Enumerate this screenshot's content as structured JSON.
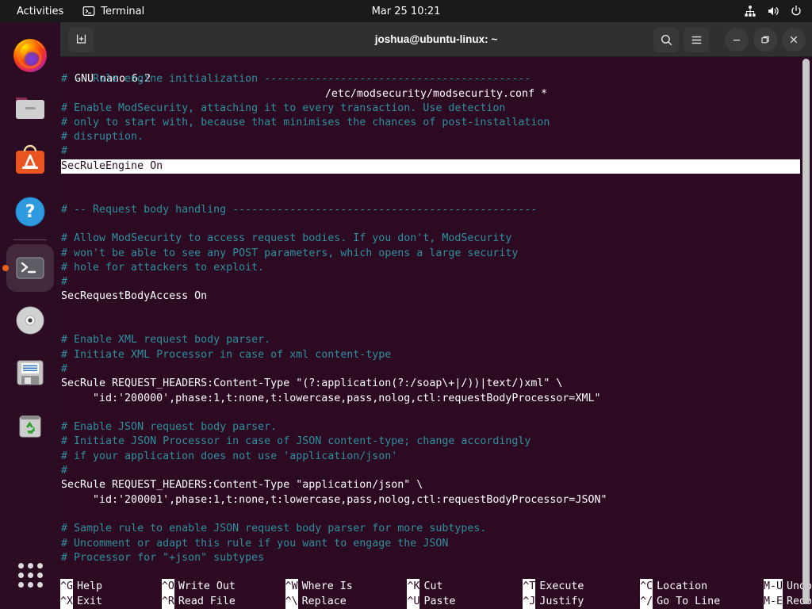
{
  "topbar": {
    "activities_label": "Activities",
    "app_label": "Terminal",
    "clock": "Mar 25  10:21",
    "icons": [
      "network-icon",
      "volume-icon",
      "power-icon"
    ]
  },
  "dock": {
    "items": [
      {
        "name": "firefox",
        "label": "Firefox"
      },
      {
        "name": "files",
        "label": "Files"
      },
      {
        "name": "ubuntu-software",
        "label": "Ubuntu Software"
      },
      {
        "name": "help",
        "label": "Help"
      },
      {
        "name": "terminal",
        "label": "Terminal",
        "running": true
      },
      {
        "name": "cd-drive",
        "label": "CD Drive"
      },
      {
        "name": "disk-image",
        "label": "Disk"
      },
      {
        "name": "trash",
        "label": "Trash"
      }
    ],
    "show_apps_label": "Show Applications"
  },
  "window": {
    "title": "joshua@ubuntu-linux: ~",
    "new_tab_label": "+",
    "search_label": "search-icon",
    "menu_label": "hamburger-icon",
    "minimize_label": "–",
    "maximize_label": "❐",
    "close_label": "×"
  },
  "nano": {
    "app_title": "GNU nano 6.2",
    "file_title": "/etc/modsecurity/modsecurity.conf *",
    "lines": [
      {
        "text": "# -- Rule engine initialization ------------------------------------------",
        "style": "comment"
      },
      {
        "text": "",
        "style": "plain"
      },
      {
        "text": "# Enable ModSecurity, attaching it to every transaction. Use detection",
        "style": "comment"
      },
      {
        "text": "# only to start with, because that minimises the chances of post-installation",
        "style": "comment"
      },
      {
        "text": "# disruption.",
        "style": "comment"
      },
      {
        "text": "#",
        "style": "comment"
      },
      {
        "text": "SecRuleEngine On",
        "style": "highlight"
      },
      {
        "text": "",
        "style": "plain"
      },
      {
        "text": "",
        "style": "plain"
      },
      {
        "text": "# -- Request body handling ------------------------------------------------",
        "style": "comment"
      },
      {
        "text": "",
        "style": "plain"
      },
      {
        "text": "# Allow ModSecurity to access request bodies. If you don't, ModSecurity",
        "style": "comment"
      },
      {
        "text": "# won't be able to see any POST parameters, which opens a large security",
        "style": "comment"
      },
      {
        "text": "# hole for attackers to exploit.",
        "style": "comment"
      },
      {
        "text": "#",
        "style": "comment"
      },
      {
        "text": "SecRequestBodyAccess On",
        "style": "plain"
      },
      {
        "text": "",
        "style": "plain"
      },
      {
        "text": "",
        "style": "plain"
      },
      {
        "text": "# Enable XML request body parser.",
        "style": "comment"
      },
      {
        "text": "# Initiate XML Processor in case of xml content-type",
        "style": "comment"
      },
      {
        "text": "#",
        "style": "comment"
      },
      {
        "text": "SecRule REQUEST_HEADERS:Content-Type \"(?:application(?:/soap\\+|/))|text/)xml\" \\",
        "style": "plain"
      },
      {
        "text": "     \"id:'200000',phase:1,t:none,t:lowercase,pass,nolog,ctl:requestBodyProcessor=XML\"",
        "style": "plain"
      },
      {
        "text": "",
        "style": "plain"
      },
      {
        "text": "# Enable JSON request body parser.",
        "style": "comment"
      },
      {
        "text": "# Initiate JSON Processor in case of JSON content-type; change accordingly",
        "style": "comment"
      },
      {
        "text": "# if your application does not use 'application/json'",
        "style": "comment"
      },
      {
        "text": "#",
        "style": "comment"
      },
      {
        "text": "SecRule REQUEST_HEADERS:Content-Type \"application/json\" \\",
        "style": "plain"
      },
      {
        "text": "     \"id:'200001',phase:1,t:none,t:lowercase,pass,nolog,ctl:requestBodyProcessor=JSON\"",
        "style": "plain"
      },
      {
        "text": "",
        "style": "plain"
      },
      {
        "text": "# Sample rule to enable JSON request body parser for more subtypes.",
        "style": "comment"
      },
      {
        "text": "# Uncomment or adapt this rule if you want to engage the JSON",
        "style": "comment"
      },
      {
        "text": "# Processor for \"+json\" subtypes",
        "style": "comment"
      }
    ],
    "shortcuts_row1": [
      {
        "key": "^G",
        "label": "Help"
      },
      {
        "key": "^O",
        "label": "Write Out"
      },
      {
        "key": "^W",
        "label": "Where Is"
      },
      {
        "key": "^K",
        "label": "Cut"
      },
      {
        "key": "^T",
        "label": "Execute"
      },
      {
        "key": "^C",
        "label": "Location"
      },
      {
        "key": "M-U",
        "label": "Undo"
      }
    ],
    "shortcuts_row2": [
      {
        "key": "^X",
        "label": "Exit"
      },
      {
        "key": "^R",
        "label": "Read File"
      },
      {
        "key": "^\\",
        "label": "Replace"
      },
      {
        "key": "^U",
        "label": "Paste"
      },
      {
        "key": "^J",
        "label": "Justify"
      },
      {
        "key": "^/",
        "label": "Go To Line"
      },
      {
        "key": "M-E",
        "label": "Redo"
      }
    ]
  },
  "colors": {
    "terminal_bg": "#2c0a22",
    "comment": "#2f8f9d",
    "text": "#ffffff",
    "topbar_bg": "#1a1a1a",
    "titlebar_bg": "#303030",
    "accent": "#e8601c"
  }
}
